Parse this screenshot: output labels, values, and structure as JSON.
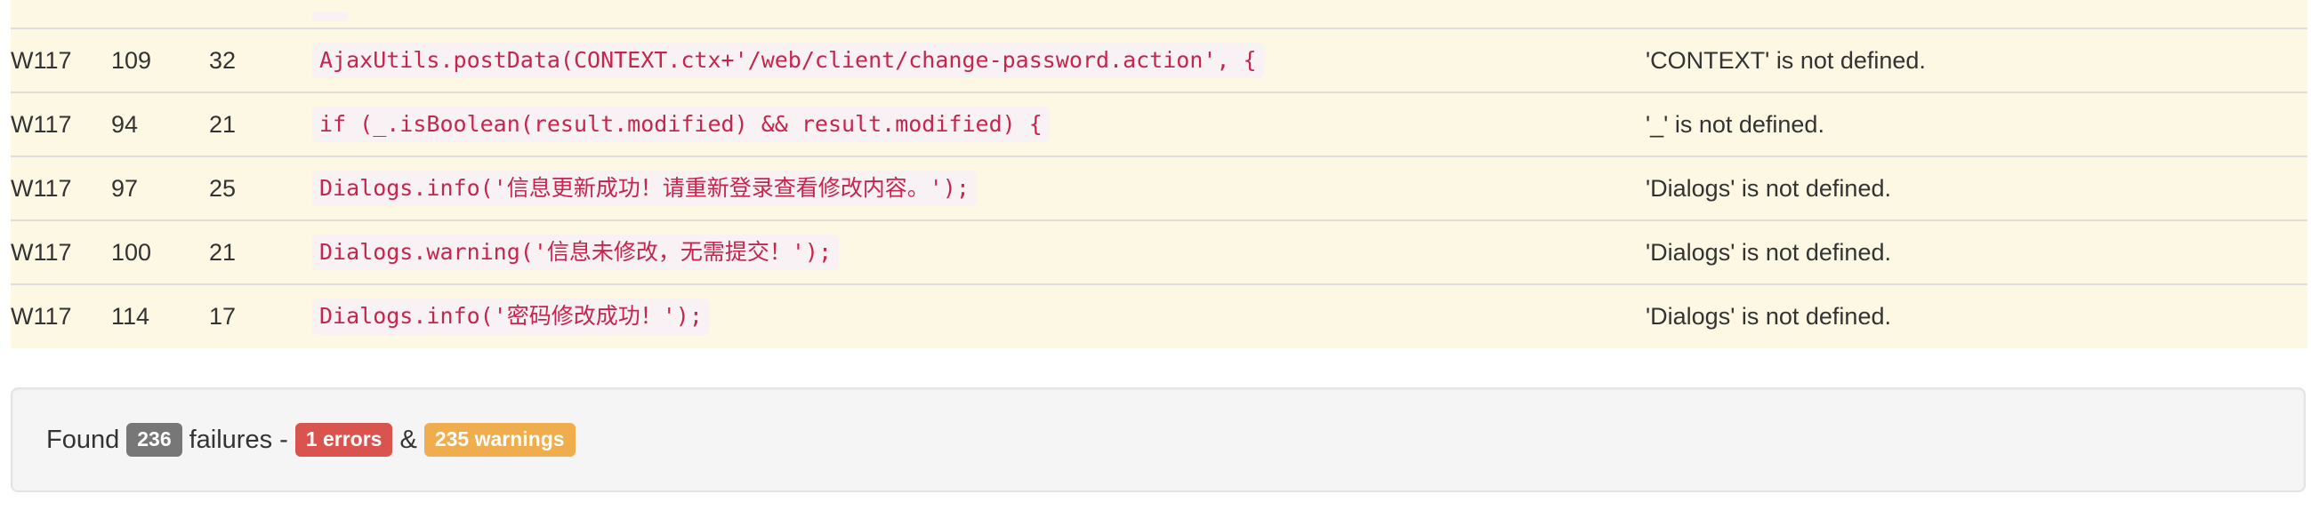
{
  "rows": [
    {
      "code": "W117",
      "line": "109",
      "col": "32",
      "evidence": "AjaxUtils.postData(CONTEXT.ctx+'/web/client/change-password.action', {",
      "reason": "'CONTEXT' is not defined."
    },
    {
      "code": "W117",
      "line": "94",
      "col": "21",
      "evidence": "if (_.isBoolean(result.modified) && result.modified) {",
      "reason": "'_' is not defined."
    },
    {
      "code": "W117",
      "line": "97",
      "col": "25",
      "evidence": "Dialogs.info('信息更新成功！请重新登录查看修改内容。');",
      "reason": "'Dialogs' is not defined."
    },
    {
      "code": "W117",
      "line": "100",
      "col": "21",
      "evidence": "Dialogs.warning('信息未修改，无需提交！');",
      "reason": "'Dialogs' is not defined."
    },
    {
      "code": "W117",
      "line": "114",
      "col": "17",
      "evidence": "Dialogs.info('密码修改成功！');",
      "reason": "'Dialogs' is not defined."
    }
  ],
  "summary": {
    "found_label": "Found",
    "total": "236",
    "failures_label": "failures -",
    "errors": "1 errors",
    "and_label": "&",
    "warnings": "235 warnings"
  },
  "colors": {
    "row_background": "#fcf8e3",
    "code_text": "#c7254e",
    "code_background": "#f9f2f4",
    "badge_default": "#777777",
    "badge_danger": "#d9534f",
    "badge_warning": "#f0ad4e"
  }
}
